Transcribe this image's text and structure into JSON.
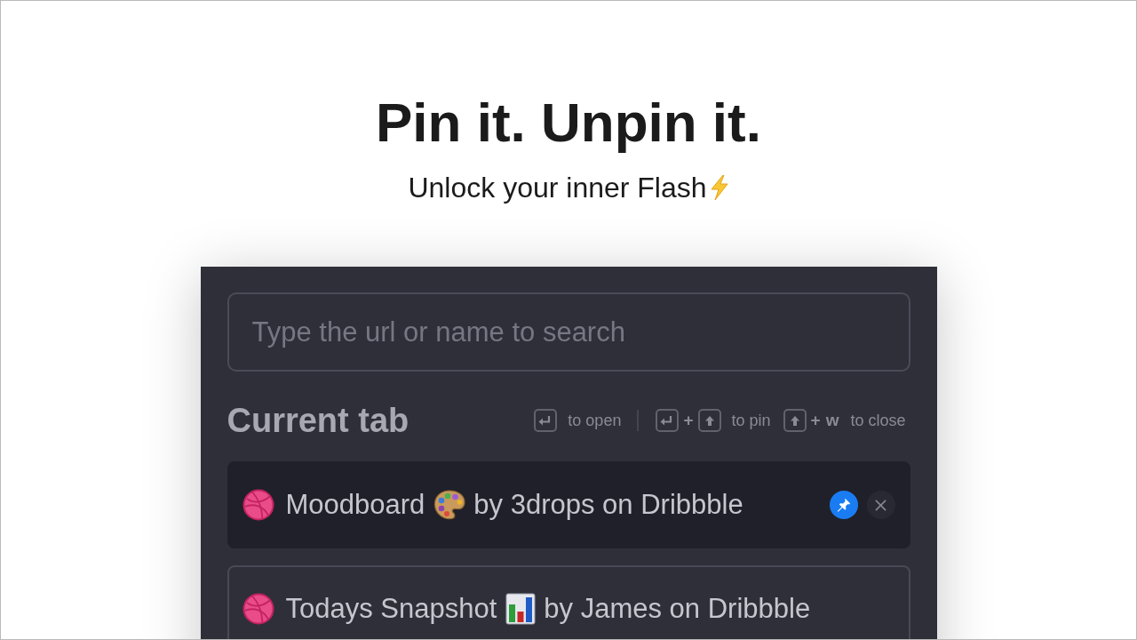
{
  "headline": "Pin it. Unpin it.",
  "tagline": "Unlock your inner Flash",
  "panel": {
    "search": {
      "placeholder": "Type the url or name to search"
    },
    "section_title": "Current tab",
    "shortcut_groups": [
      {
        "items": [
          {
            "keys": [
              {
                "kind": "enter"
              }
            ],
            "label": "to open"
          }
        ]
      },
      {
        "items": [
          {
            "keys": [
              {
                "kind": "enter"
              },
              {
                "kind": "text",
                "text": "+"
              },
              {
                "kind": "shift"
              }
            ],
            "label": "to pin"
          },
          {
            "keys": [
              {
                "kind": "shift"
              },
              {
                "kind": "text",
                "text": "+"
              },
              {
                "kind": "text",
                "text": "w"
              }
            ],
            "label": "to close"
          }
        ]
      }
    ],
    "tabs": [
      {
        "title": "Moodboard",
        "byline": "by 3drops on Dribbble",
        "selected": true
      },
      {
        "title": "Todays Snapshot",
        "byline": "by James on Dribbble",
        "selected": false
      }
    ]
  }
}
